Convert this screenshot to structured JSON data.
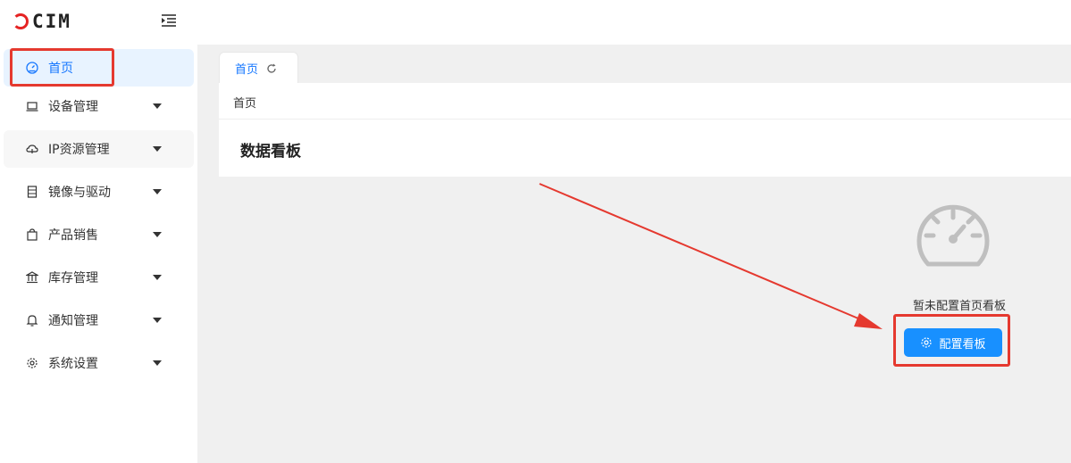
{
  "app": {
    "logo_text": "CIM"
  },
  "sidebar": {
    "items": [
      {
        "label": "首页",
        "icon": "dashboard-icon",
        "active": true
      },
      {
        "label": "设备管理",
        "icon": "laptop-icon"
      },
      {
        "label": "IP资源管理",
        "icon": "cloud-icon"
      },
      {
        "label": "镜像与驱动",
        "icon": "server-icon"
      },
      {
        "label": "产品销售",
        "icon": "shopping-bag-icon"
      },
      {
        "label": "库存管理",
        "icon": "bank-icon"
      },
      {
        "label": "通知管理",
        "icon": "bell-icon"
      },
      {
        "label": "系统设置",
        "icon": "gear-icon"
      }
    ]
  },
  "tabs": [
    {
      "label": "首页",
      "icon": "refresh-icon"
    }
  ],
  "breadcrumb": "首页",
  "dashboard": {
    "title": "数据看板",
    "empty_text": "暂未配置首页看板",
    "config_button": "配置看板"
  },
  "colors": {
    "accent": "#1890ff",
    "active_bg": "#e8f3ff",
    "annotation": "#e5392f",
    "logo": "#e52323"
  }
}
